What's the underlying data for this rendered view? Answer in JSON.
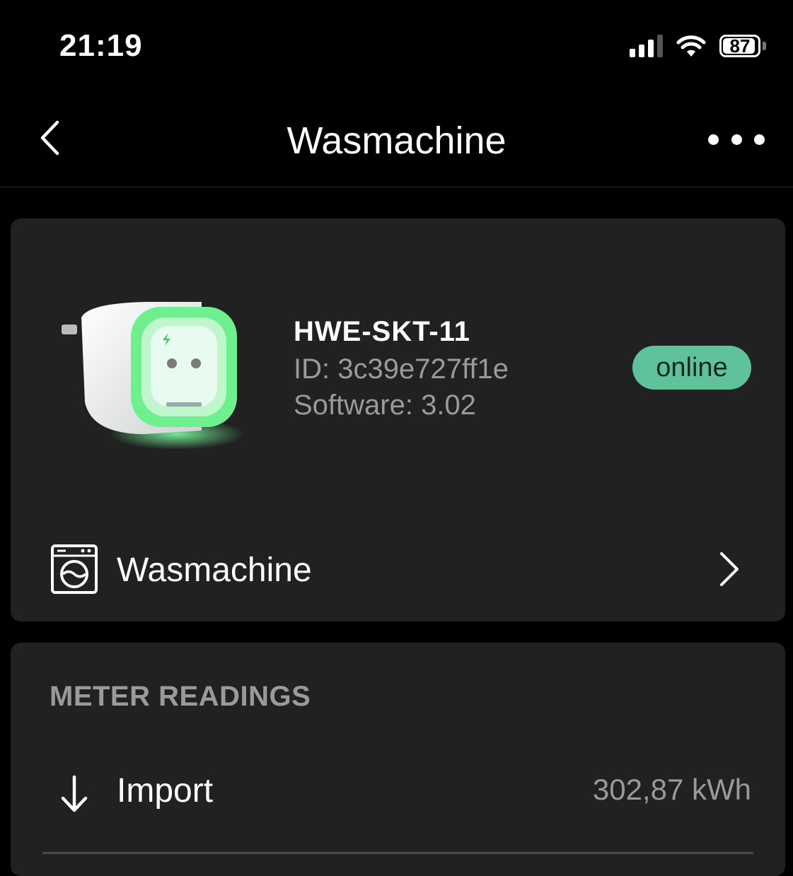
{
  "status_bar": {
    "time": "21:19",
    "battery": "87",
    "icons": [
      "cellular-signal-icon",
      "wifi-icon",
      "battery-icon"
    ]
  },
  "nav": {
    "title": "Wasmachine",
    "back_icon": "chevron-left-icon",
    "more_icon": "more-dots-icon"
  },
  "device": {
    "model": "HWE-SKT-11",
    "id_line": "ID: 3c39e727ff1e",
    "software_line": "Software: 3.02",
    "status": "online",
    "status_color": "#5fc29b",
    "image": "energy-socket-image"
  },
  "appliance": {
    "icon": "washing-machine-icon",
    "label": "Wasmachine",
    "chevron_icon": "chevron-right-icon"
  },
  "meter_readings": {
    "title": "METER READINGS",
    "rows": [
      {
        "icon": "arrow-down-icon",
        "label": "Import",
        "value": "302,87 kWh"
      }
    ]
  }
}
